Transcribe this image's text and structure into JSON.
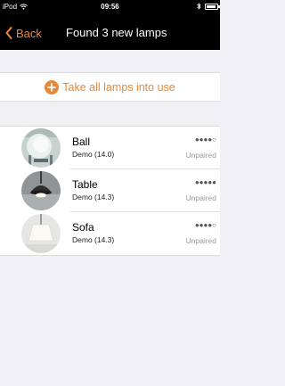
{
  "status_bar": {
    "carrier": "iPod",
    "time": "09:56"
  },
  "nav": {
    "back_label": "Back",
    "title": "Found 3 new lamps"
  },
  "action": {
    "label": "Take all lamps into use"
  },
  "lamps": [
    {
      "name": "Ball",
      "subtitle": "Demo (14.0)",
      "signal": "●●●●○",
      "status": "Unpaired"
    },
    {
      "name": "Table",
      "subtitle": "Demo (14.3)",
      "signal": "●●●●●",
      "status": "Unpaired"
    },
    {
      "name": "Sofa",
      "subtitle": "Demo (14.3)",
      "signal": "●●●●○",
      "status": "Unpaired"
    }
  ],
  "colors": {
    "accent": "#e8893a",
    "bar_background": "#000000",
    "page_background": "#efeff4"
  }
}
